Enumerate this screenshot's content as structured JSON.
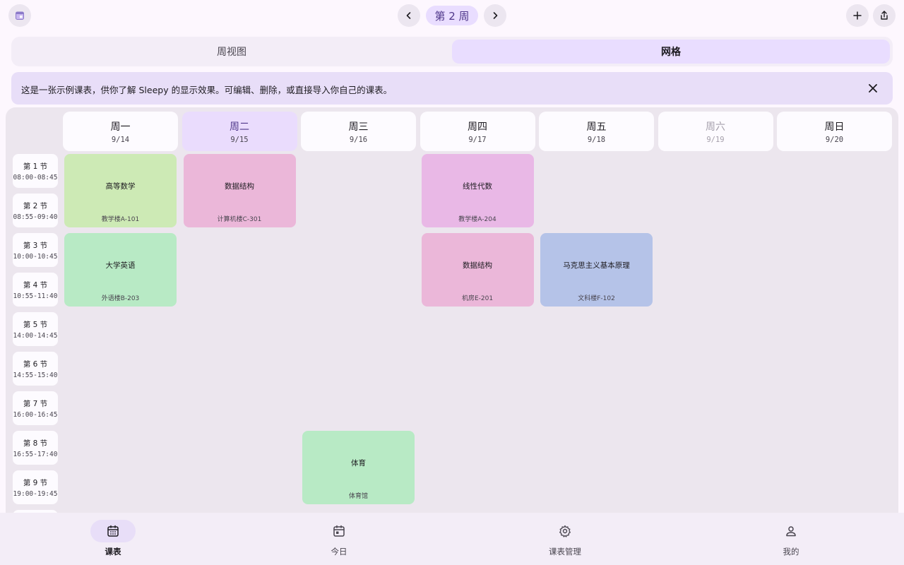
{
  "header": {
    "app_icon": "calendar-app-icon",
    "week_label": "第 2 周",
    "prev_icon": "chevron-left-icon",
    "next_icon": "chevron-right-icon",
    "add_icon": "plus-icon",
    "share_icon": "share-icon"
  },
  "view_tabs": [
    {
      "label": "周视图",
      "selected": false
    },
    {
      "label": "网格",
      "selected": true
    }
  ],
  "banner": {
    "text": "这是一张示例课表，供你了解 Sleepy 的显示效果。可编辑、删除，或直接导入你自己的课表。",
    "close_icon": "close-icon"
  },
  "days": [
    {
      "name": "周一",
      "date": "9/14"
    },
    {
      "name": "周二",
      "date": "9/15",
      "today": true
    },
    {
      "name": "周三",
      "date": "9/16"
    },
    {
      "name": "周四",
      "date": "9/17"
    },
    {
      "name": "周五",
      "date": "9/18"
    },
    {
      "name": "周六",
      "date": "9/19",
      "weekend_dim": true
    },
    {
      "name": "周日",
      "date": "9/20"
    }
  ],
  "periods": [
    {
      "label": "第 1 节",
      "time": "08:00-08:45"
    },
    {
      "label": "第 2 节",
      "time": "08:55-09:40"
    },
    {
      "label": "第 3 节",
      "time": "10:00-10:45"
    },
    {
      "label": "第 4 节",
      "time": "10:55-11:40"
    },
    {
      "label": "第 5 节",
      "time": "14:00-14:45"
    },
    {
      "label": "第 6 节",
      "time": "14:55-15:40"
    },
    {
      "label": "第 7 节",
      "time": "16:00-16:45"
    },
    {
      "label": "第 8 节",
      "time": "16:55-17:40"
    },
    {
      "label": "第 9 节",
      "time": "19:00-19:45"
    }
  ],
  "courses": [
    {
      "name": "高等数学",
      "location": "教学楼A-101",
      "day": 0,
      "start": 1,
      "end": 2,
      "color": "#cdeab5"
    },
    {
      "name": "数据结构",
      "location": "计算机楼C-301",
      "day": 1,
      "start": 1,
      "end": 2,
      "color": "#ebb7d9"
    },
    {
      "name": "线性代数",
      "location": "教学楼A-204",
      "day": 3,
      "start": 1,
      "end": 2,
      "color": "#e9b8e6"
    },
    {
      "name": "大学英语",
      "location": "外语楼B-203",
      "day": 0,
      "start": 3,
      "end": 4,
      "color": "#b8eac5"
    },
    {
      "name": "数据结构",
      "location": "机房E-201",
      "day": 3,
      "start": 3,
      "end": 4,
      "color": "#ebb7d9"
    },
    {
      "name": "马克思主义基本原理",
      "location": "文科楼F-102",
      "day": 4,
      "start": 3,
      "end": 4,
      "color": "#b5c3e8"
    },
    {
      "name": "体育",
      "location": "体育馆",
      "day": 2,
      "start": 8,
      "end": 9,
      "color": "#b8eac5"
    }
  ],
  "bottom_nav": [
    {
      "label": "课表",
      "icon": "calendar-grid-icon",
      "active": true
    },
    {
      "label": "今日",
      "icon": "calendar-today-icon",
      "active": false
    },
    {
      "label": "课表管理",
      "icon": "gear-icon",
      "active": false
    },
    {
      "label": "我的",
      "icon": "person-icon",
      "active": false
    }
  ]
}
